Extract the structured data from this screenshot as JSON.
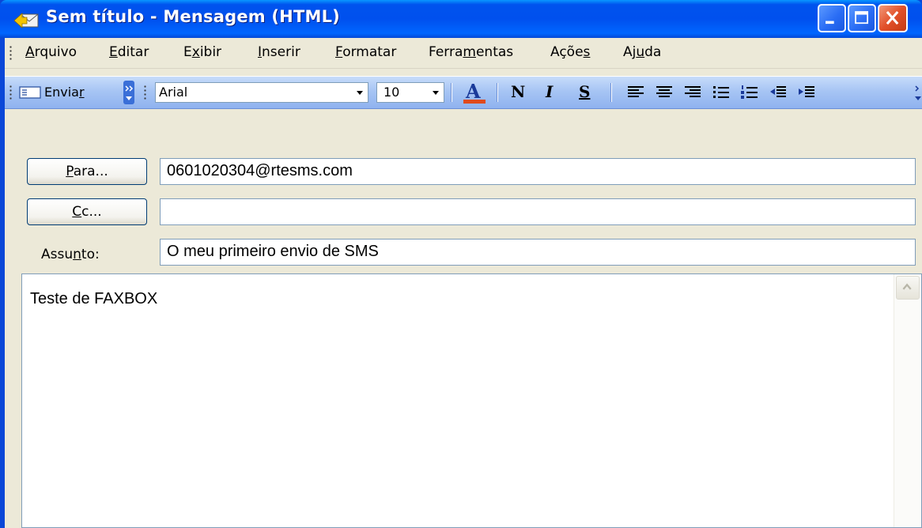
{
  "window": {
    "title": "Sem título - Mensagem (HTML)"
  },
  "menu": {
    "items": [
      {
        "pre": "",
        "u": "A",
        "post": "rquivo"
      },
      {
        "pre": "",
        "u": "E",
        "post": "ditar"
      },
      {
        "pre": "E",
        "u": "x",
        "post": "ibir"
      },
      {
        "pre": "",
        "u": "I",
        "post": "nserir"
      },
      {
        "pre": "",
        "u": "F",
        "post": "ormatar"
      },
      {
        "pre": "Ferra",
        "u": "m",
        "post": "entas"
      },
      {
        "pre": "Açõe",
        "u": "s",
        "post": ""
      },
      {
        "pre": "Aj",
        "u": "u",
        "post": "da"
      }
    ]
  },
  "toolbar": {
    "send_pre": "Envia",
    "send_u": "r",
    "font_name": "Arial",
    "font_size": "10",
    "bold_label": "N",
    "italic_label": "I",
    "underline_label": "S",
    "font_color": "#e04a1c"
  },
  "header": {
    "to_button": {
      "u": "P",
      "post": "ara..."
    },
    "cc_button": {
      "u": "C",
      "post": "c..."
    },
    "subject_label": {
      "pre": "Assu",
      "u": "n",
      "post": "to:"
    },
    "to_value": "0601020304@rtesms.com",
    "cc_value": "",
    "subject_value": "O meu primeiro envio de SMS"
  },
  "message": {
    "body": "Teste de FAXBOX"
  }
}
